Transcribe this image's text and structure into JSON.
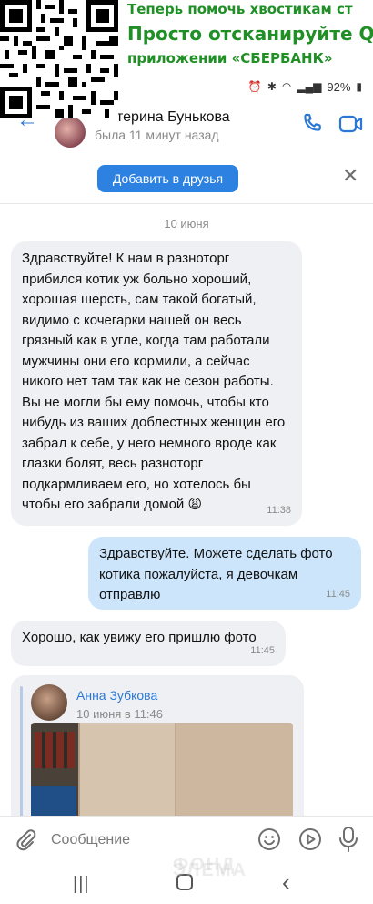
{
  "banner": {
    "line1": "Теперь помочь хвостикам ст",
    "line2": "Просто отсканируйте Q",
    "line3": "приложении «СБЕРБАНК»"
  },
  "status_bar": {
    "battery": "92%"
  },
  "header": {
    "contact_name": "терина Бунькова",
    "last_seen": "была 11 минут назад"
  },
  "add_friend": {
    "button_label": "Добавить в друзья"
  },
  "chat": {
    "date_separator": "10 июня",
    "messages": [
      {
        "direction": "incoming",
        "text": "Здравствуйте! К нам в разноторг прибился котик уж больно хороший, хорошая шерсть, сам такой богатый, видимо с кочегарки нашей он весь грязный как в угле, когда там работали мужчины они его кормили, а сейчас никого нет там так как не сезон работы.\nВы не могли бы ему помочь, чтобы кто нибудь из ваших доблестных женщин его забрал к себе, у него немного вроде как глазки болят, весь разноторг подкармливаем его, но хотелось бы чтобы его забрали домой 😩",
        "time": "11:38"
      },
      {
        "direction": "outgoing",
        "text": "Здравствуйте.  Можете сделать фото котика пожалуйста,  я девочкам отправлю",
        "time": "11:45"
      },
      {
        "direction": "incoming",
        "text": "Хорошо, как увижу его пришлю фото",
        "time": "11:45"
      }
    ],
    "forwarded": {
      "author": "Анна Зубкова",
      "date": "10 июня в 11:46"
    }
  },
  "composer": {
    "placeholder": "Сообщение"
  },
  "watermark": {
    "left": "ФОНД",
    "right": "ЭЛЕМА"
  }
}
